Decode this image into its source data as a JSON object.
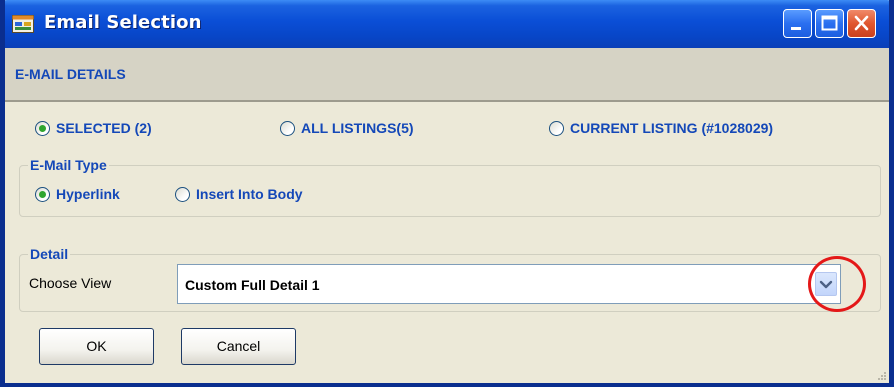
{
  "window": {
    "title": "Email Selection",
    "icons": {
      "app": "app-form-icon",
      "minimize": "minimize-icon",
      "maximize": "maximize-icon",
      "close": "close-icon"
    },
    "colors": {
      "titlebar": "#0a4ed6",
      "section_text": "#1448b8",
      "radio_dot": "#2fa52f",
      "highlight_ring": "#e41818"
    }
  },
  "header": {
    "title": "E-MAIL DETAILS"
  },
  "scope": {
    "options": [
      {
        "label": "SELECTED (2)",
        "checked": true
      },
      {
        "label": "ALL LISTINGS(5)",
        "checked": false
      },
      {
        "label": "CURRENT LISTING (#1028029)",
        "checked": false
      }
    ]
  },
  "email_type": {
    "group_label": "E-Mail Type",
    "options": [
      {
        "label": "Hyperlink",
        "checked": true
      },
      {
        "label": "Insert Into Body",
        "checked": false
      }
    ]
  },
  "detail": {
    "group_label": "Detail",
    "choose_view_label": "Choose View",
    "selected_view": "Custom Full Detail 1",
    "dropdown_icon": "chevron-down-icon"
  },
  "buttons": {
    "ok_label": "OK",
    "cancel_label": "Cancel"
  }
}
